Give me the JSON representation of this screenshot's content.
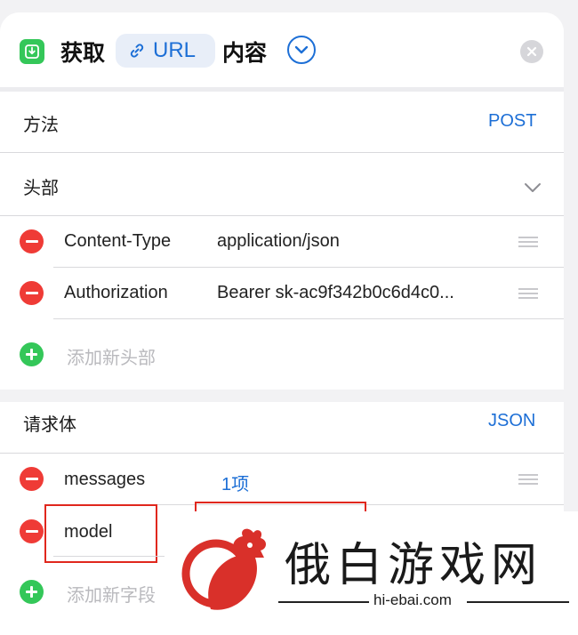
{
  "header": {
    "action_verb": "获取",
    "url_token": "URL",
    "action_noun": "内容",
    "icons": {
      "app": "download-tray-icon",
      "link": "link-icon",
      "expand": "chevron-down-circle-icon",
      "close": "close-x-icon"
    }
  },
  "method": {
    "label": "方法",
    "value": "POST"
  },
  "headers_section": {
    "label": "头部",
    "items": [
      {
        "key": "Content-Type",
        "value": "application/json"
      },
      {
        "key": "Authorization",
        "value": "Bearer sk-ac9f342b0c6d4c0..."
      }
    ],
    "add_label": "添加新头部"
  },
  "body_section": {
    "label": "请求体",
    "value": "JSON",
    "items": [
      {
        "key": "messages",
        "value": "1项"
      },
      {
        "key": "model",
        "value": ""
      }
    ],
    "add_label": "添加新字段"
  },
  "watermark": {
    "text": "俄白游戏网",
    "url": "hi-ebai.com"
  },
  "colors": {
    "accent": "#1d6fd6",
    "remove": "#ef3b36",
    "add": "#34c759",
    "highlight_box": "#e0271d",
    "logo": "#d9302a"
  }
}
